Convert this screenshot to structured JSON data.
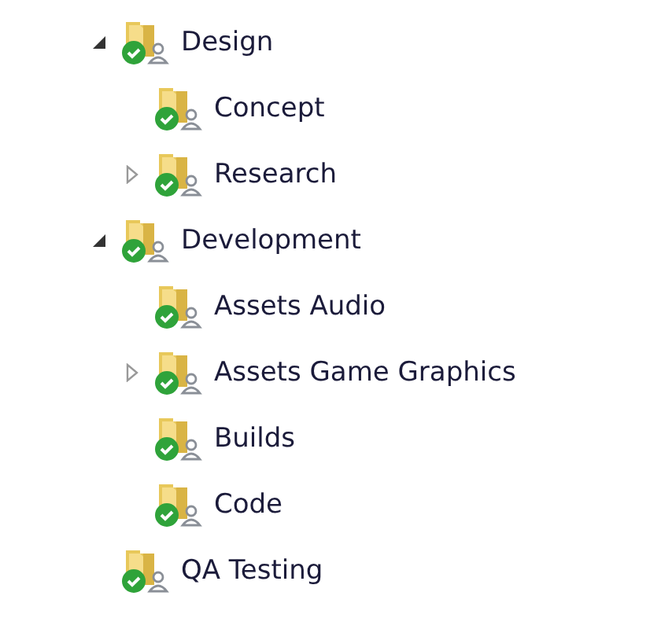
{
  "tree": [
    {
      "label": "Design",
      "expanded": true,
      "children": [
        {
          "label": "Concept"
        },
        {
          "label": "Research",
          "expanded": false
        }
      ]
    },
    {
      "label": "Development",
      "expanded": true,
      "children": [
        {
          "label": "Assets Audio"
        },
        {
          "label": "Assets Game Graphics",
          "expanded": false
        },
        {
          "label": "Builds"
        },
        {
          "label": "Code"
        }
      ]
    },
    {
      "label": "QA Testing"
    }
  ]
}
